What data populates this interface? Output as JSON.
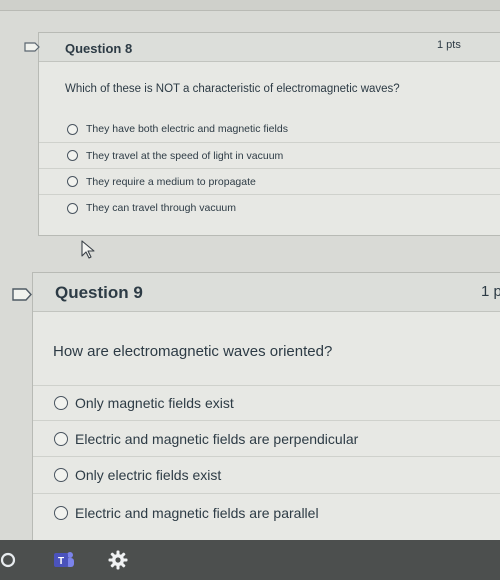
{
  "questions": [
    {
      "title": "Question 8",
      "points": "1 pts",
      "prompt": "Which of these is NOT a characteristic of electromagnetic waves?",
      "answers": [
        "They have both electric and magnetic fields",
        "They travel at the speed of light in vacuum",
        "They require a medium to propagate",
        "They can travel through vacuum"
      ]
    },
    {
      "title": "Question 9",
      "points": "1 p",
      "prompt": "How are electromagnetic waves oriented?",
      "answers": [
        "Only magnetic fields exist",
        "Electric and magnetic fields are perpendicular",
        "Only electric fields exist",
        "Electric and magnetic fields are parallel"
      ]
    }
  ],
  "taskbar": {
    "items": [
      "circle-app-icon",
      "teams-icon",
      "settings-gear-icon"
    ],
    "teams_letter": "T"
  }
}
